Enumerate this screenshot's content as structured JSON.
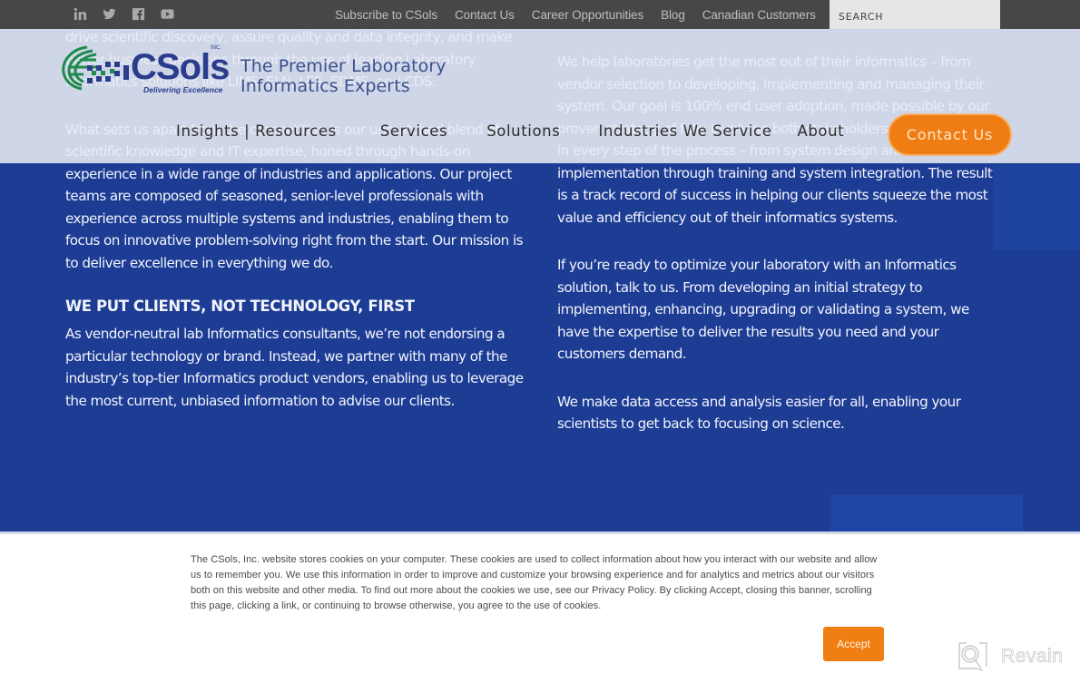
{
  "topbar": {
    "social_icons": [
      "linkedin-icon",
      "twitter-icon",
      "facebook-icon",
      "youtube-icon"
    ],
    "links": [
      "Subscribe to CSols",
      "Contact Us",
      "Career Opportunities",
      "Blog",
      "Canadian Customers"
    ],
    "search_placeholder": "SEARCH"
  },
  "header": {
    "logo_word": "CSols",
    "logo_inc": "INC.",
    "logo_tagline": "Delivering Excellence",
    "tagline_line1": "The Premier Laboratory",
    "tagline_line2": "Informatics Experts",
    "nav": [
      "Insights | Resources",
      "Services",
      "Solutions",
      "Industries We Service",
      "About"
    ],
    "contact_button": "Contact Us"
  },
  "content": {
    "left": {
      "p1": "drive scientific discovery, assure quality and data integrity, and make better business decisions through the use of leading Laboratory Informatics solutions like LIMS, ELN, LES, SDMS, and CDS.",
      "p2": "What sets us apart from the competition is our unmatched blend of scientific knowledge and IT expertise, honed through hands-on experience in a wide range of industries and applications. Our project teams are composed of seasoned, senior-level professionals with experience across multiple systems and industries, enabling them to focus on innovative problem-solving right from the start. Our mission is to deliver excellence in everything we do.",
      "heading": "WE PUT CLIENTS, NOT TECHNOLOGY, FIRST",
      "p3": "As vendor-neutral lab Informatics consultants, we’re not endorsing a particular technology or brand. Instead, we partner with many of the industry’s top-tier Informatics product vendors, enabling us to leverage the most current, unbiased information to advise our clients."
    },
    "right": {
      "p1": "We help laboratories get the most out of their informatics – from vendor selection to developing, implementing and managing their system. Our goal is 100% end user adoption, made possible by our proven strategy of fully involving both stakeholders and end users in every step of the process – from system design and implementation through training and system integration. The result is a track record of success in helping our clients squeeze the most value and efficiency out of their informatics systems.",
      "p2": "If you’re ready to optimize your laboratory with an Informatics solution, talk to us. From developing an initial strategy to implementing, enhancing, upgrading or validating a system, we have the expertise to deliver the results you need and your customers demand.",
      "p3": "We make data access and analysis easier for all, enabling your scientists to get back to focusing on science."
    }
  },
  "cookie_banner": {
    "text": "The CSols, Inc. website stores cookies on your computer. These cookies are used to collect information about how you interact with our website and allow us to remember you. We use this information in order to improve and customize your browsing experience and for analytics and metrics about our visitors both on this website and other media. To find out more about the cookies we use, see our Privacy Policy. By clicking Accept, closing this banner, scrolling this page, clicking a link, or continuing to browse otherwise, you agree to the use of cookies.",
    "accept_label": "Accept"
  },
  "watermark": {
    "label": "Revain"
  },
  "colors": {
    "topbar_bg": "#474747",
    "content_bg": "#1d3c94",
    "accent_orange": "#f07c14",
    "logo_blue": "#2b3c8d",
    "logo_green": "#1f8a4c"
  }
}
